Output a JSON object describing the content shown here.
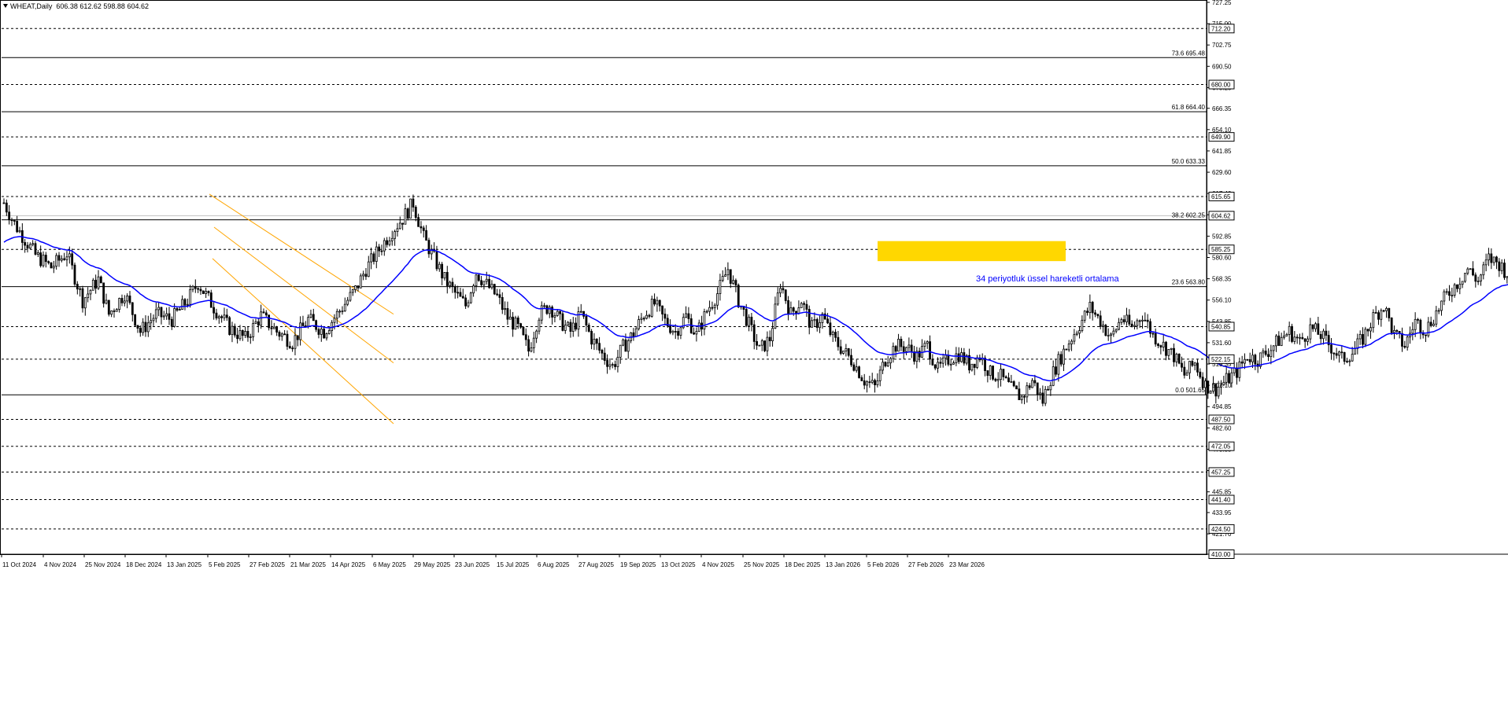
{
  "header": {
    "symbol": "WHEAT,Daily",
    "ohlc": "606.38 612.62 598.88 604.62"
  },
  "chart_data": {
    "type": "candlestick",
    "symbol": "WHEAT",
    "timeframe": "Daily",
    "ohlc_last": {
      "open": 606.38,
      "high": 612.62,
      "low": 598.88,
      "close": 604.62
    },
    "y_range": [
      410.0,
      727.25
    ],
    "price_ticks": [
      "727.25",
      "715.00",
      "702.75",
      "690.50",
      "678.25",
      "666.35",
      "654.10",
      "641.85",
      "629.60",
      "617.40",
      "605.15",
      "592.85",
      "580.60",
      "568.35",
      "556.10",
      "543.85",
      "531.60",
      "519.35",
      "507.10",
      "494.85",
      "482.60",
      "470.35",
      "458.10",
      "445.85",
      "433.95",
      "421.70",
      "410.00"
    ],
    "time_axis": [
      "11 Oct 2024",
      "4 Nov 2024",
      "25 Nov 2024",
      "18 Dec 2024",
      "13 Jan 2025",
      "5 Feb 2025",
      "27 Feb 2025",
      "21 Mar 2025",
      "14 Apr 2025",
      "6 May 2025",
      "29 May 2025",
      "23 Jun 2025",
      "15 Jul 2025",
      "6 Aug 2025",
      "27 Aug 2025",
      "19 Sep 2025",
      "13 Oct 2025",
      "4 Nov 2025",
      "25 Nov 2025",
      "18 Dec 2025",
      "13 Jan 2026",
      "5 Feb 2026",
      "27 Feb 2026",
      "23 Mar 2026"
    ],
    "horizontal_levels": [
      712.2,
      680.0,
      649.9,
      615.65,
      585.25,
      540.85,
      522.15,
      487.5,
      472.05,
      457.25,
      441.4,
      424.5
    ],
    "level_labels": [
      "712.20",
      "680.00",
      "649.90",
      "615.65",
      "585.25",
      "540.85",
      "522.15",
      "487.50",
      "472.05",
      "457.25",
      "441.40",
      "424.50",
      "410.00"
    ],
    "current_price": 604.62,
    "current_price_label": "604.62",
    "fibonacci": [
      {
        "label": "73.6 695.48",
        "value": 695.48
      },
      {
        "label": "61.8 664.40",
        "value": 664.4
      },
      {
        "label": "50.0 633.33",
        "value": 633.33
      },
      {
        "label": "38.2 602.25",
        "value": 602.25
      },
      {
        "label": "23.6 563.80",
        "value": 563.8
      },
      {
        "label": "0.0 501.65",
        "value": 501.65
      }
    ],
    "zone": {
      "from": 578.5,
      "to": 590.0,
      "color": "#FFD700"
    },
    "ema_label": "34 periyotluk üssel hareketli ortalama",
    "ema_period": 34,
    "colors": {
      "candle": "#000000",
      "ema": "#0000FF",
      "channel": "#FFA500",
      "zone": "#FFD700",
      "annotation": "#0000FF"
    },
    "price_path": [
      [
        0,
        612
      ],
      [
        4,
        600
      ],
      [
        12,
        582
      ],
      [
        18,
        575
      ],
      [
        24,
        583
      ],
      [
        30,
        556
      ],
      [
        36,
        568
      ],
      [
        40,
        548
      ],
      [
        46,
        560
      ],
      [
        52,
        538
      ],
      [
        58,
        548
      ],
      [
        64,
        545
      ],
      [
        70,
        556
      ],
      [
        74,
        566
      ],
      [
        80,
        552
      ],
      [
        86,
        540
      ],
      [
        92,
        534
      ],
      [
        98,
        547
      ],
      [
        104,
        538
      ],
      [
        110,
        532
      ],
      [
        116,
        545
      ],
      [
        122,
        538
      ],
      [
        128,
        550
      ],
      [
        134,
        562
      ],
      [
        138,
        574
      ],
      [
        142,
        583
      ],
      [
        148,
        596
      ],
      [
        152,
        603
      ],
      [
        156,
        612
      ],
      [
        160,
        592
      ],
      [
        164,
        580
      ],
      [
        168,
        568
      ],
      [
        172,
        560
      ],
      [
        176,
        553
      ],
      [
        180,
        572
      ],
      [
        184,
        565
      ],
      [
        188,
        558
      ],
      [
        192,
        546
      ],
      [
        196,
        540
      ],
      [
        200,
        527
      ],
      [
        204,
        548
      ],
      [
        208,
        553
      ],
      [
        212,
        544
      ],
      [
        216,
        538
      ],
      [
        220,
        548
      ],
      [
        224,
        534
      ],
      [
        228,
        525
      ],
      [
        232,
        518
      ],
      [
        236,
        529
      ],
      [
        240,
        537
      ],
      [
        244,
        548
      ],
      [
        248,
        554
      ],
      [
        252,
        544
      ],
      [
        256,
        538
      ],
      [
        260,
        547
      ],
      [
        264,
        536
      ],
      [
        268,
        550
      ],
      [
        272,
        560
      ],
      [
        276,
        574
      ],
      [
        280,
        556
      ],
      [
        284,
        542
      ],
      [
        288,
        527
      ],
      [
        292,
        534
      ],
      [
        296,
        566
      ],
      [
        300,
        548
      ],
      [
        304,
        556
      ],
      [
        308,
        540
      ],
      [
        312,
        547
      ],
      [
        316,
        534
      ],
      [
        320,
        527
      ],
      [
        324,
        520
      ],
      [
        328,
        510
      ],
      [
        332,
        506
      ],
      [
        336,
        522
      ],
      [
        340,
        530
      ],
      [
        344,
        529
      ],
      [
        348,
        524
      ],
      [
        352,
        530
      ],
      [
        356,
        516
      ],
      [
        360,
        522
      ],
      [
        364,
        525
      ],
      [
        368,
        519
      ],
      [
        372,
        524
      ],
      [
        376,
        514
      ],
      [
        380,
        512
      ],
      [
        384,
        505
      ],
      [
        388,
        500
      ],
      [
        392,
        510
      ],
      [
        396,
        498
      ],
      [
        398,
        508
      ],
      [
        402,
        521
      ],
      [
        406,
        532
      ],
      [
        410,
        542
      ],
      [
        414,
        552
      ],
      [
        418,
        544
      ],
      [
        422,
        534
      ],
      [
        426,
        546
      ],
      [
        430,
        540
      ],
      [
        434,
        548
      ],
      [
        438,
        536
      ],
      [
        442,
        530
      ],
      [
        446,
        524
      ],
      [
        450,
        513
      ],
      [
        454,
        520
      ],
      [
        458,
        507
      ],
      [
        462,
        505
      ],
      [
        466,
        510
      ],
      [
        470,
        515
      ],
      [
        474,
        524
      ],
      [
        478,
        522
      ],
      [
        482,
        527
      ],
      [
        486,
        533
      ],
      [
        490,
        538
      ],
      [
        494,
        532
      ],
      [
        498,
        540
      ],
      [
        502,
        536
      ],
      [
        506,
        529
      ],
      [
        510,
        522
      ],
      [
        514,
        526
      ],
      [
        518,
        534
      ],
      [
        522,
        546
      ],
      [
        526,
        553
      ],
      [
        530,
        536
      ],
      [
        534,
        530
      ],
      [
        538,
        544
      ],
      [
        542,
        539
      ],
      [
        546,
        549
      ],
      [
        550,
        559
      ],
      [
        554,
        566
      ],
      [
        558,
        574
      ],
      [
        562,
        567
      ],
      [
        566,
        580
      ],
      [
        570,
        577
      ],
      [
        574,
        570
      ],
      [
        578,
        565
      ],
      [
        582,
        575
      ],
      [
        586,
        580
      ],
      [
        590,
        583
      ],
      [
        594,
        590
      ],
      [
        598,
        585
      ],
      [
        602,
        580
      ],
      [
        606,
        592
      ],
      [
        610,
        602
      ],
      [
        614,
        608
      ],
      [
        618,
        600
      ],
      [
        622,
        606
      ],
      [
        626,
        604
      ]
    ]
  }
}
